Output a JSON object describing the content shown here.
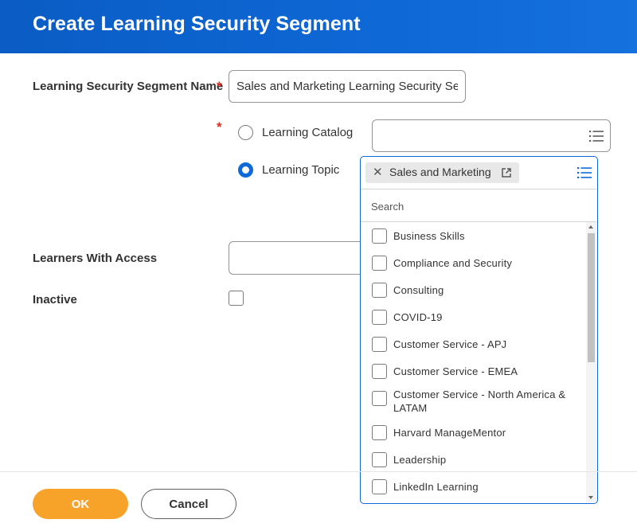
{
  "header": {
    "title": "Create Learning Security Segment"
  },
  "form": {
    "segment_name": {
      "label": "Learning Security Segment Name",
      "required_mark": "*",
      "value": "Sales and Marketing Learning Security Segment"
    },
    "source": {
      "required_mark": "*",
      "options": [
        {
          "label": "Learning Catalog",
          "selected": false
        },
        {
          "label": "Learning Topic",
          "selected": true
        }
      ]
    },
    "learners": {
      "label": "Learners With Access",
      "value": ""
    },
    "inactive": {
      "label": "Inactive",
      "checked": false
    }
  },
  "topic_picker": {
    "selected_pill": "Sales and Marketing",
    "remove_icon": "close-icon",
    "link_icon": "external-link-icon",
    "search_placeholder": "Search",
    "options": [
      "Business Skills",
      "Compliance and Security",
      "Consulting",
      "COVID-19",
      "Customer Service - APJ",
      "Customer Service - EMEA",
      "Customer Service - North America & LATAM",
      "Harvard ManageMentor",
      "Leadership",
      "LinkedIn Learning"
    ]
  },
  "footer": {
    "ok_label": "OK",
    "cancel_label": "Cancel"
  },
  "colors": {
    "header_blue": "#0e68d6",
    "accent_blue": "#0e6ad8",
    "required_red": "#de2e21",
    "ok_orange": "#f7a228"
  }
}
